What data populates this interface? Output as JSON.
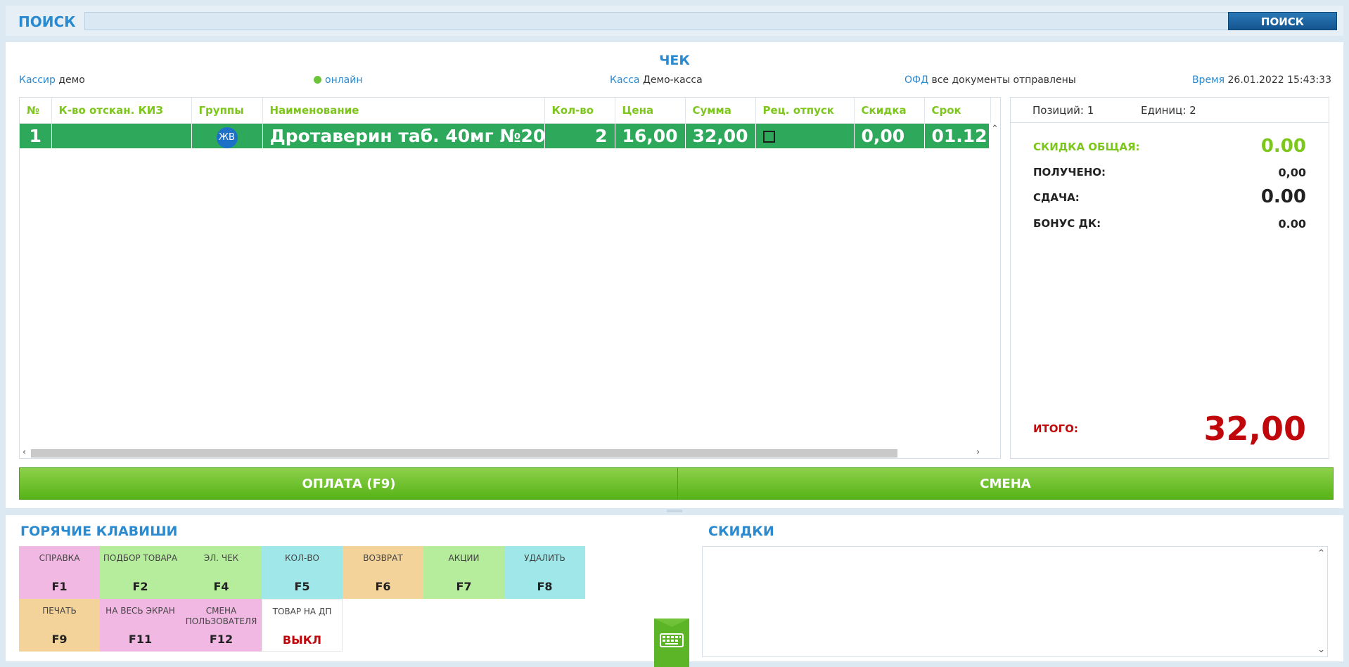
{
  "search": {
    "title": "ПОИСК",
    "input_value": "",
    "button_label": "ПОИСК"
  },
  "receipt": {
    "title": "ЧЕК",
    "cashier_label": "Кассир",
    "cashier_value": "демо",
    "status_text": "онлайн",
    "register_label": "Касса",
    "register_value": "Демо-касса",
    "ofd_label": "ОФД",
    "ofd_value": "все документы отправлены",
    "time_label": "Время",
    "time_value": "26.01.2022 15:43:33"
  },
  "table": {
    "columns": [
      "№",
      "К-во отскан. КИЗ",
      "Группы",
      "Наименование",
      "Кол-во",
      "Цена",
      "Сумма",
      "Рец. отпуск",
      "Скидка",
      "Срок"
    ],
    "rows": [
      {
        "num": "1",
        "kiz": "",
        "group": "ЖВ",
        "name": "Дротаверин таб. 40мг №20",
        "qty": "2",
        "price": "16,00",
        "sum": "32,00",
        "rx": false,
        "discount": "0,00",
        "expiry": "01.12"
      }
    ]
  },
  "summary": {
    "positions": "Позиций: 1",
    "units": "Единиц: 2",
    "discount_label": "СКИДКА ОБЩАЯ:",
    "discount_value": "0.00",
    "received_label": "ПОЛУЧЕНО:",
    "received_value": "0,00",
    "change_label": "СДАЧА:",
    "change_value": "0.00",
    "bonus_label": "БОНУС ДК:",
    "bonus_value": "0.00",
    "total_label": "ИТОГО:",
    "total_value": "32,00"
  },
  "actions": {
    "pay_label": "ОПЛАТА (F9)",
    "shift_label": "СМЕНА"
  },
  "hotkeys": {
    "title": "ГОРЯЧИЕ КЛАВИШИ",
    "items": [
      {
        "label": "СПРАВКА",
        "key": "F1"
      },
      {
        "label": "ПОДБОР ТОВАРА",
        "key": "F2"
      },
      {
        "label": "ЭЛ. ЧЕК",
        "key": "F4"
      },
      {
        "label": "КОЛ-ВО",
        "key": "F5"
      },
      {
        "label": "ВОЗВРАТ",
        "key": "F6"
      },
      {
        "label": "АКЦИИ",
        "key": "F7"
      },
      {
        "label": "УДАЛИТЬ",
        "key": "F8"
      },
      {
        "label": "ПЕЧАТЬ",
        "key": "F9"
      },
      {
        "label": "НА ВЕСЬ ЭКРАН",
        "key": "F11"
      },
      {
        "label": "СМЕНА ПОЛЬЗОВАТЕЛЯ",
        "key": "F12"
      },
      {
        "label": "ТОВАР НА ДП",
        "key": "ВЫКЛ"
      }
    ]
  },
  "discounts": {
    "title": "СКИДКИ"
  },
  "colors": {
    "accent_blue": "#2a8ad0",
    "accent_green": "#7dc61c",
    "row_green": "#2ea95b",
    "total_red": "#c0070c"
  }
}
